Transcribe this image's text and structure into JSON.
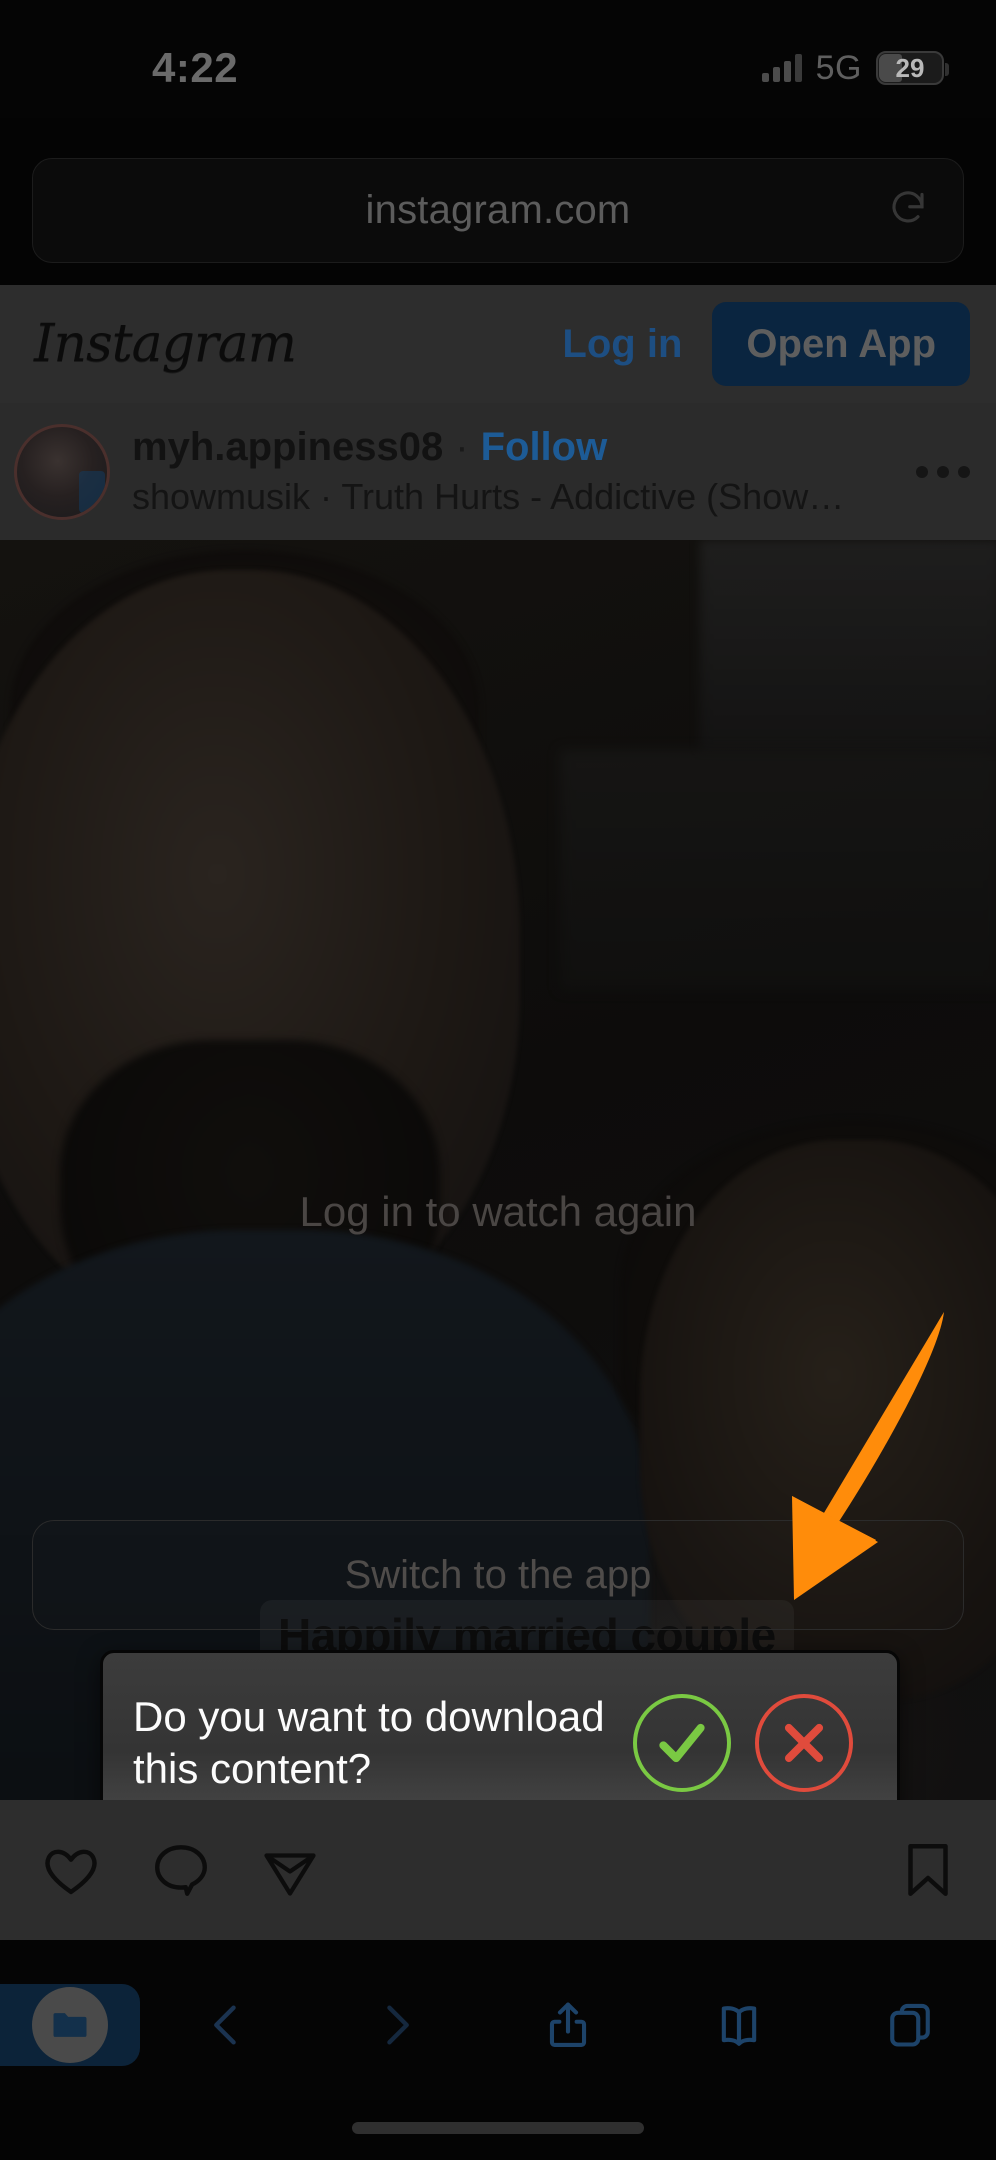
{
  "status_bar": {
    "time": "4:22",
    "network": "5G",
    "battery_level": "29",
    "signal_icon": "cellular-signal-icon",
    "battery_icon": "battery-icon"
  },
  "browser": {
    "url": "instagram.com",
    "reload_icon": "reload-icon",
    "toolbar": {
      "downloads_icon": "downloads-folder-icon",
      "back_icon": "chevron-left-icon",
      "forward_icon": "chevron-right-icon",
      "share_icon": "share-icon",
      "bookmarks_icon": "book-icon",
      "tabs_icon": "tabs-icon"
    }
  },
  "instagram": {
    "logo_text": "Instagram",
    "login_label": "Log in",
    "open_app_label": "Open App",
    "post": {
      "username": "myh.appiness08",
      "separator": "·",
      "follow_label": "Follow",
      "music": "showmusik · Truth Hurts - Addictive (Showmusi...",
      "more_icon": "more-options-icon",
      "avatar_icon": "user-avatar"
    },
    "media": {
      "watch_again_label": "Log in to watch again",
      "switch_app_label": "Switch to the app",
      "caption": "Happily married couple"
    },
    "actions": {
      "like_icon": "heart-icon",
      "comment_icon": "comment-icon",
      "share_icon": "paper-plane-icon",
      "save_icon": "bookmark-icon"
    }
  },
  "download_dialog": {
    "message": "Do you want to download this content?",
    "confirm_icon": "checkmark-icon",
    "cancel_icon": "close-x-icon",
    "confirm_color": "#7ac943",
    "cancel_color": "#e04b3c"
  },
  "annotation": {
    "arrow_icon": "orange-pointer-arrow",
    "arrow_color": "#FF8C0A"
  }
}
